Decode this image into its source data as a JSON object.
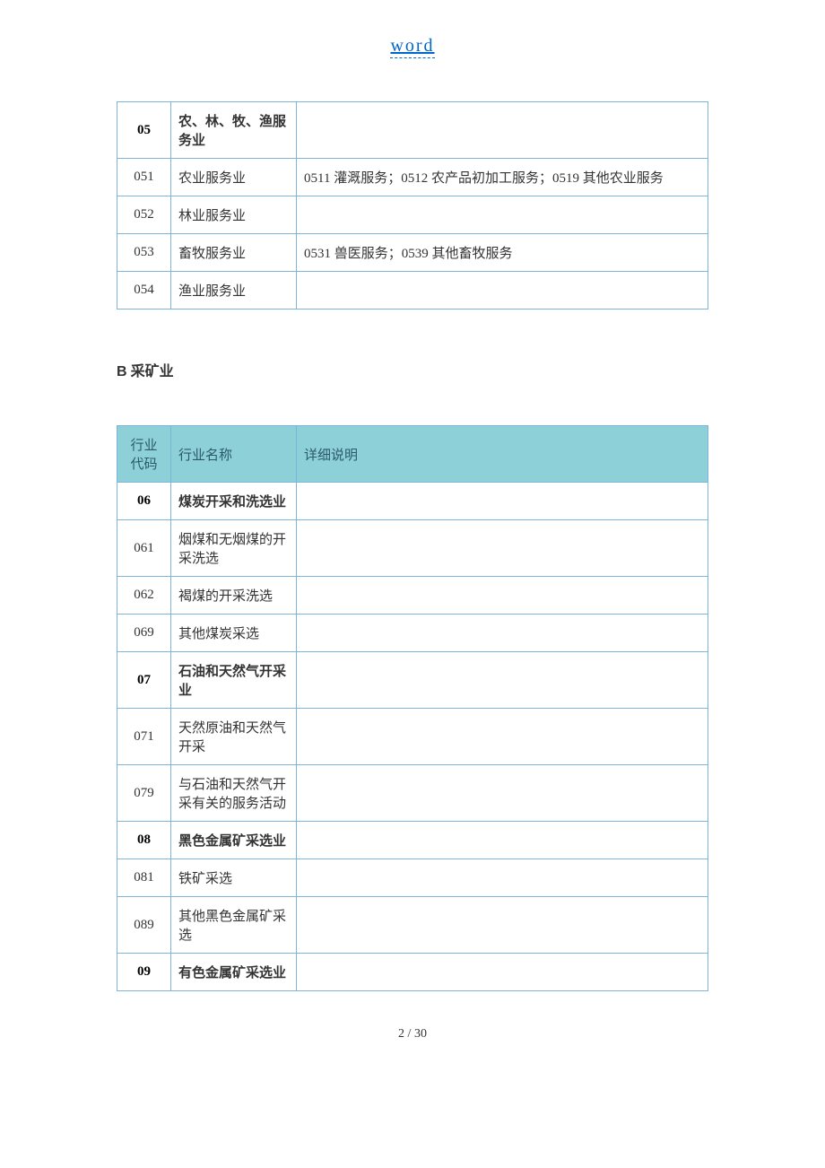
{
  "header": {
    "link_text": "word"
  },
  "table1": {
    "rows": [
      {
        "code": "05",
        "name": "农、林、牧、渔服务业",
        "desc": "",
        "bold": true
      },
      {
        "code": "051",
        "name": "农业服务业",
        "desc": "0511 灌溉服务；0512 农产品初加工服务；0519 其他农业服务",
        "bold": false
      },
      {
        "code": "052",
        "name": "林业服务业",
        "desc": "",
        "bold": false
      },
      {
        "code": "053",
        "name": "畜牧服务业",
        "desc": "0531 兽医服务；0539 其他畜牧服务",
        "bold": false
      },
      {
        "code": "054",
        "name": "渔业服务业",
        "desc": "",
        "bold": false
      }
    ]
  },
  "section_b": {
    "letter": "B",
    "title": "采矿业"
  },
  "table2": {
    "headers": {
      "code": "行业代码",
      "name": "行业名称",
      "desc": "详细说明"
    },
    "rows": [
      {
        "code": "06",
        "name": "煤炭开采和洗选业",
        "desc": "",
        "bold": true
      },
      {
        "code": "061",
        "name": "烟煤和无烟煤的开采洗选",
        "desc": "",
        "bold": false
      },
      {
        "code": "062",
        "name": "褐煤的开采洗选",
        "desc": "",
        "bold": false
      },
      {
        "code": "069",
        "name": "其他煤炭采选",
        "desc": "",
        "bold": false
      },
      {
        "code": "07",
        "name": "石油和天然气开采业",
        "desc": "",
        "bold": true
      },
      {
        "code": "071",
        "name": "天然原油和天然气开采",
        "desc": "",
        "bold": false
      },
      {
        "code": "079",
        "name": "与石油和天然气开采有关的服务活动",
        "desc": "",
        "bold": false
      },
      {
        "code": "08",
        "name": "黑色金属矿采选业",
        "desc": "",
        "bold": true
      },
      {
        "code": "081",
        "name": "铁矿采选",
        "desc": "",
        "bold": false
      },
      {
        "code": "089",
        "name": "其他黑色金属矿采选",
        "desc": "",
        "bold": false
      },
      {
        "code": "09",
        "name": "有色金属矿采选业",
        "desc": "",
        "bold": true
      }
    ]
  },
  "footer": {
    "page_current": "2",
    "page_separator": " / ",
    "page_total": "30"
  }
}
